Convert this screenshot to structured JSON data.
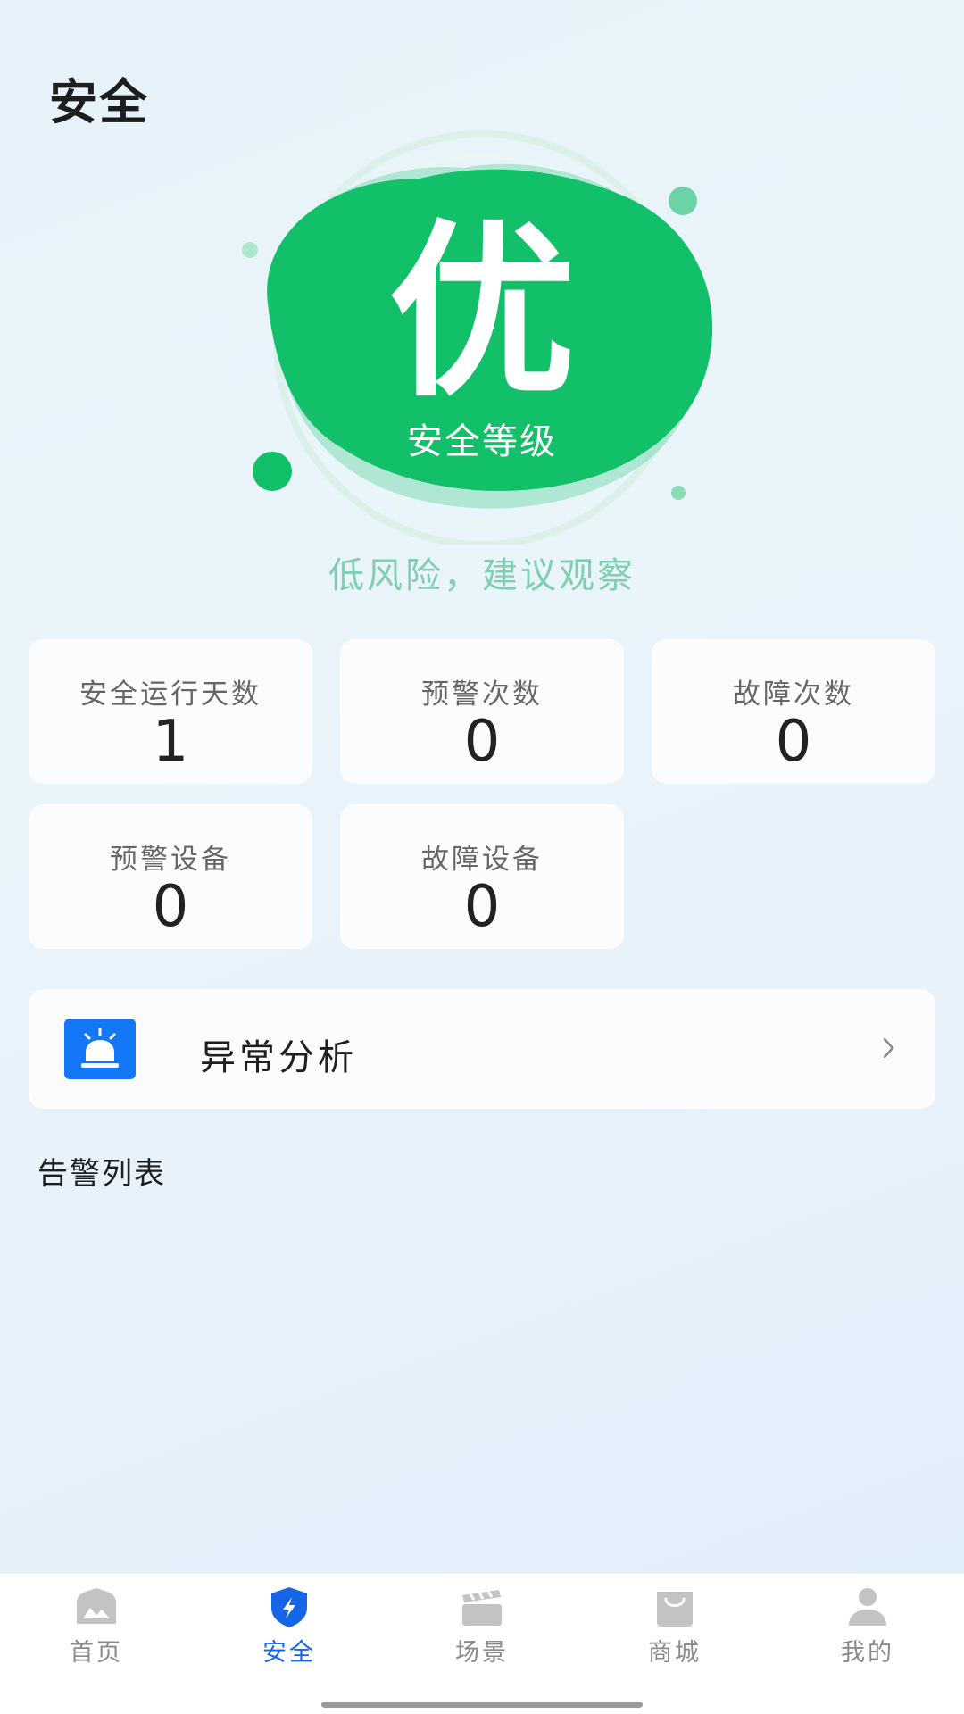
{
  "header": {
    "title": "安全"
  },
  "safety": {
    "grade": "优",
    "grade_label": "安全等级",
    "risk_text": "低风险，建议观察",
    "grade_color": "#10c06a"
  },
  "stats": [
    {
      "label": "安全运行天数",
      "value": "1"
    },
    {
      "label": "预警次数",
      "value": "0"
    },
    {
      "label": "故障次数",
      "value": "0"
    },
    {
      "label": "预警设备",
      "value": "0"
    },
    {
      "label": "故障设备",
      "value": "0"
    }
  ],
  "analysis": {
    "title": "异常分析",
    "icon": "alarm-light-icon",
    "chevron": "chevron-right-icon"
  },
  "alarm_list": {
    "title": "告警列表"
  },
  "tabbar": {
    "items": [
      {
        "label": "首页",
        "icon": "home-mountain-icon"
      },
      {
        "label": "安全",
        "icon": "shield-bolt-icon",
        "active": true
      },
      {
        "label": "场景",
        "icon": "clapperboard-icon"
      },
      {
        "label": "商城",
        "icon": "shopping-bag-icon"
      },
      {
        "label": "我的",
        "icon": "user-icon"
      }
    ],
    "active_color": "#1466e6",
    "inactive_color": "#c3c3c3"
  }
}
